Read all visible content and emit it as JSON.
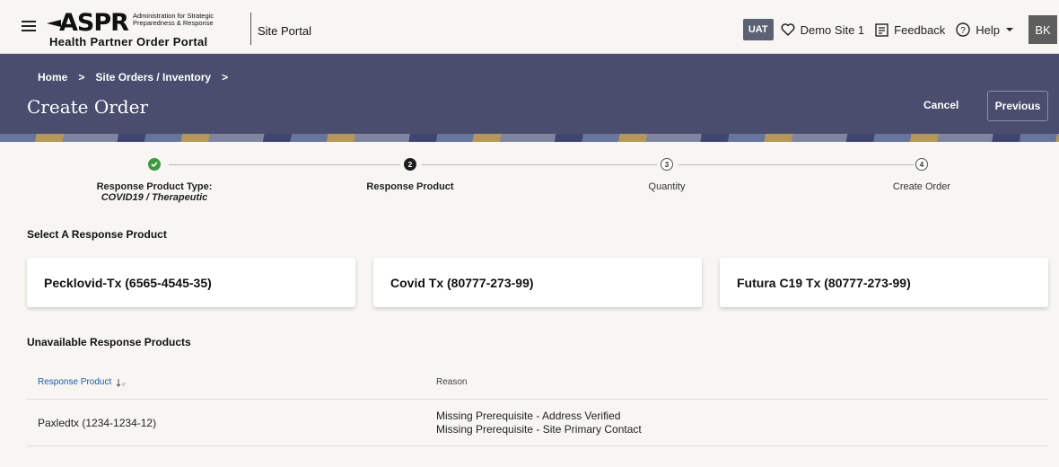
{
  "header": {
    "logo_text": "ASPR",
    "logo_tagline": "Administration for Strategic Preparedness & Response",
    "logo_subtitle": "Health Partner Order Portal",
    "portal_label": "Site Portal",
    "env_badge": "UAT",
    "site_name": "Demo Site 1",
    "feedback_label": "Feedback",
    "help_label": "Help",
    "avatar_initials": "BK",
    "icons": [
      "menu-icon",
      "heart-icon",
      "feedback-icon",
      "help-icon",
      "chevron-down-icon"
    ]
  },
  "banner": {
    "breadcrumbs": [
      "Home",
      "Site Orders / Inventory"
    ],
    "breadcrumb_separator": ">",
    "title": "Create Order",
    "cancel_label": "Cancel",
    "previous_label": "Previous"
  },
  "stepper": {
    "steps": [
      {
        "number": "1",
        "label": "Response Product Type:",
        "sublabel": "COVID19 / Therapeutic",
        "status": "complete"
      },
      {
        "number": "2",
        "label": "Response Product",
        "sublabel": "",
        "status": "active"
      },
      {
        "number": "3",
        "label": "Quantity",
        "sublabel": "",
        "status": "pending"
      },
      {
        "number": "4",
        "label": "Create Order",
        "sublabel": "",
        "status": "pending"
      }
    ]
  },
  "select_section": {
    "title": "Select A Response Product",
    "products": [
      "Pecklovid-Tx (6565-4545-35)",
      "Covid Tx (80777-273-99)",
      "Futura C19 Tx (80777-273-99)"
    ]
  },
  "unavailable_section": {
    "title": "Unavailable Response Products",
    "columns": {
      "product": "Response Product",
      "reason": "Reason"
    },
    "rows": [
      {
        "product": "Paxledtx (1234-1234-12)",
        "reasons": [
          "Missing Prerequisite - Address Verified",
          "Missing Prerequisite - Site Primary Contact"
        ]
      }
    ]
  },
  "colors": {
    "banner": "#4a4d6e",
    "complete": "#3d9b3f",
    "link": "#1e5ba8",
    "uat_badge": "#5b6273"
  }
}
